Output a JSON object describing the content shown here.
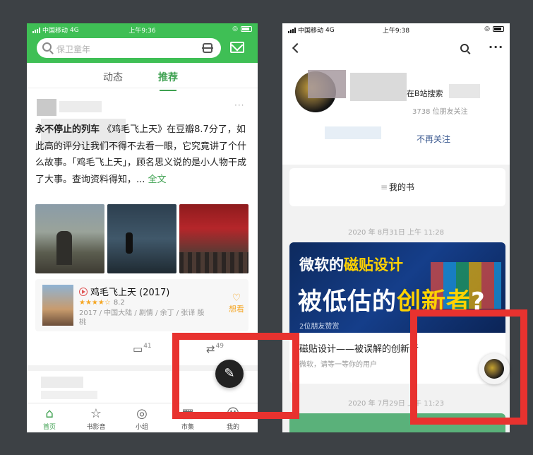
{
  "left": {
    "status": {
      "carrier": "中国移动",
      "network": "4G",
      "time": "上午9:36"
    },
    "search": {
      "placeholder": "保卫童年"
    },
    "tabs": [
      {
        "label": "动态"
      },
      {
        "label": "推荐"
      }
    ],
    "post": {
      "more": "···",
      "head": "永不停止的列车",
      "text": "《鸡毛飞上天》在豆瓣8.7分了，如此高的评分让我们不得不去看一眼，它究竟讲了个什么故事。「鸡毛飞上天」，顾名思义说的是小人物干成了大事。查询资料得知，...",
      "full_link": "全文"
    },
    "movie": {
      "title": "鸡毛飞上天 (2017)",
      "stars": "★★★★☆",
      "score": "8.2",
      "info": "2017 / 中国大陆 / 剧情 / 余丁 / 张译 殷桃",
      "want": "想看"
    },
    "actions": {
      "comments": "41",
      "reposts": "49"
    },
    "nav": [
      {
        "label": "首页",
        "icon": "home-icon"
      },
      {
        "label": "书影音",
        "icon": "media-icon"
      },
      {
        "label": "小组",
        "icon": "group-icon"
      },
      {
        "label": "市集",
        "icon": "market-icon"
      },
      {
        "label": "我的",
        "icon": "profile-icon"
      }
    ]
  },
  "right": {
    "status": {
      "carrier": "中国移动",
      "network": "4G",
      "time": "上午9:38"
    },
    "profile": {
      "name_suffix": "在B站搜索",
      "followers": "3738 位朋友关注",
      "unfollow": "不再关注"
    },
    "my_books": "我的书",
    "date1": "2020 年 8月31日 上午 11:28",
    "article": {
      "cover_line1_a": "微软的",
      "cover_line1_b": "磁贴设计",
      "cover_line2_a": "被低估的",
      "cover_line2_b": "创新者",
      "cover_line2_c": "?",
      "likes": "2位朋友赞赏",
      "title": "磁贴设计——被误解的创新者",
      "subtitle": "微软，请等一等你的用户"
    },
    "date2": "2020 年 7月29日 上午 11:23"
  },
  "colors": {
    "brand_green": "#3fbf55",
    "annotation_red": "#e8322f",
    "link_blue": "#3c5a91"
  }
}
